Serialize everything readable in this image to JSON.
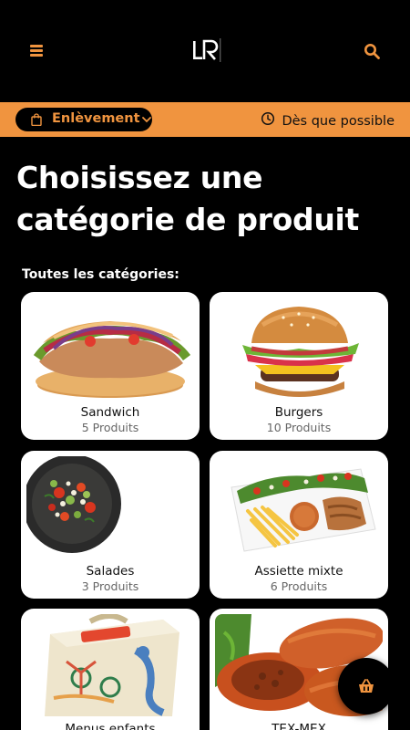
{
  "header": {
    "menu_icon": "hamburger-menu-icon",
    "logo_icon": "lr-logo-icon",
    "search_icon": "search-icon",
    "accent_color": "#f0943f"
  },
  "order_bar": {
    "mode_label": "Enlèvement",
    "mode_icon": "shopping-bag-icon",
    "time_label": "Dès que possible",
    "time_icon": "clock-icon"
  },
  "main": {
    "title": "Choisissez une catégorie de produit",
    "section_label": "Toutes les catégories:"
  },
  "categories": [
    {
      "name": "Sandwich",
      "count": "5 Produits"
    },
    {
      "name": "Burgers",
      "count": "10 Produits"
    },
    {
      "name": "Salades",
      "count": "3 Produits"
    },
    {
      "name": "Assiette mixte",
      "count": "6 Produits"
    },
    {
      "name": "Menus enfants",
      "count": ""
    },
    {
      "name": "TEX-MEX",
      "count": ""
    }
  ],
  "cart": {
    "icon": "shopping-basket-icon"
  }
}
